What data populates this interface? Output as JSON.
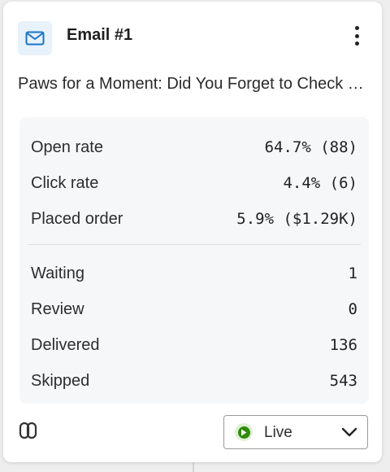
{
  "card": {
    "title": "Email #1",
    "subject": "Paws for a Moment: Did You Forget to Check Out?",
    "stats": [
      {
        "label": "Open rate",
        "value": "64.7% (88)"
      },
      {
        "label": "Click rate",
        "value": "4.4% (6)"
      },
      {
        "label": "Placed order",
        "value": "5.9% ($1.29K)"
      }
    ],
    "counts": [
      {
        "label": "Waiting",
        "value": "1"
      },
      {
        "label": "Review",
        "value": "0"
      },
      {
        "label": "Delivered",
        "value": "136"
      },
      {
        "label": "Skipped",
        "value": "543"
      }
    ],
    "status": {
      "label": "Live",
      "color": "#2f8a0d"
    },
    "icons": {
      "type": "envelope-icon",
      "menu": "kebab-menu-icon",
      "footer": "link-icon",
      "status": "play-icon",
      "dropdown": "chevron-down-icon"
    },
    "colors": {
      "icon_accent": "#1a73c8",
      "icon_bg": "#e7f2fb",
      "stats_bg": "#f6f7f9"
    }
  }
}
